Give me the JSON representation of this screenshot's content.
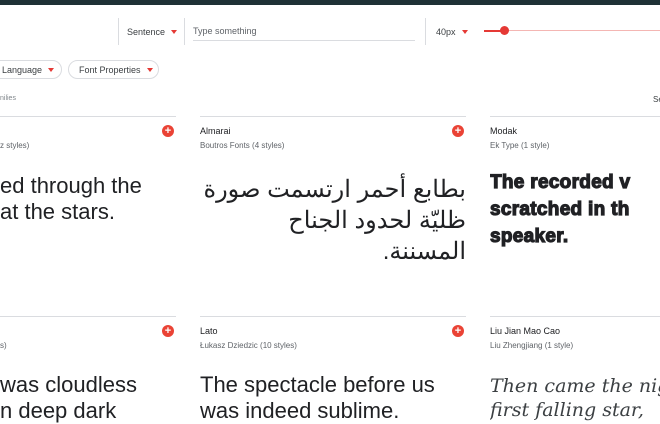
{
  "toolbar": {
    "sentence_label": "Sentence",
    "search_placeholder": "Type something",
    "size_label": "40px",
    "size_level": 0.1
  },
  "filters": {
    "language_label": "Language",
    "font_properties_label": "Font Properties"
  },
  "meta": {
    "families_fragment": "nilies",
    "right_fragment": "Se"
  },
  "colors": {
    "accent": "#e53935",
    "add_button": "#ea4335",
    "topbar": "#1f3136"
  },
  "cards": [
    {
      "title": "",
      "subtitle": "z styles)",
      "sample_lines": [
        "ed through the",
        "at the stars."
      ]
    },
    {
      "title": "Almarai",
      "subtitle": "Boutros Fonts (4 styles)",
      "sample_lines": [
        "بطابع أحمر ارتسمت صورة",
        "ظليّة لحدود الجناح",
        "المسننة."
      ]
    },
    {
      "title": "Modak",
      "subtitle": "Ek Type (1 style)",
      "sample_lines": [
        "The recorded v",
        "scratched in th",
        "speaker."
      ]
    },
    {
      "title": "",
      "subtitle": "s)",
      "sample_lines": [
        "was cloudless",
        "n deep dark"
      ]
    },
    {
      "title": "Lato",
      "subtitle": "Łukasz Dziedzic (10 styles)",
      "sample_lines": [
        "The spectacle before us",
        "was indeed sublime."
      ]
    },
    {
      "title": "Liu Jian Mao Cao",
      "subtitle": "Liu Zhengjiang (1 style)",
      "sample_lines": [
        "Then came the nig",
        "first falling star,"
      ]
    }
  ]
}
